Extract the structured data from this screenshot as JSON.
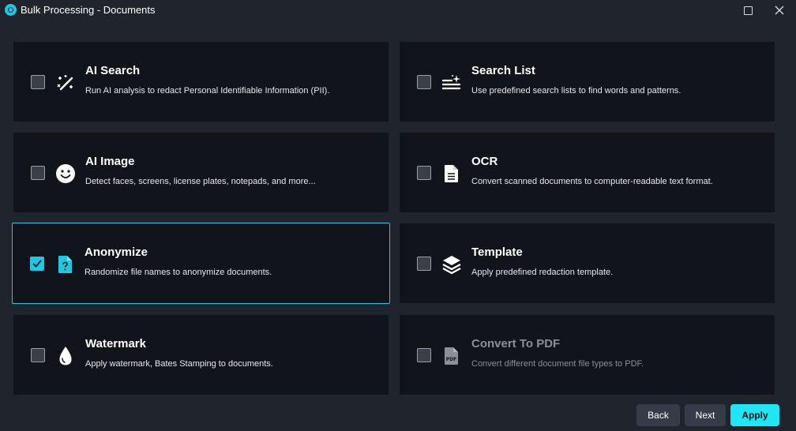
{
  "window": {
    "title": "Bulk Processing - Documents"
  },
  "colors": {
    "accent": "#1ec8e0",
    "card_bg": "#11141b",
    "window_bg": "#1f242d"
  },
  "options": [
    {
      "title": "AI Search",
      "description": "Run AI analysis to redact Personal Identifiable Information (PII).",
      "icon": "magic-wand-icon",
      "checked": false,
      "disabled": false
    },
    {
      "title": "Search List",
      "description": "Use predefined search lists to find words and patterns.",
      "icon": "sparkle-list-icon",
      "checked": false,
      "disabled": false
    },
    {
      "title": "AI Image",
      "description": "Detect faces, screens, license plates, notepads, and more...",
      "icon": "smiley-face-icon",
      "checked": false,
      "disabled": false
    },
    {
      "title": "OCR",
      "description": "Convert scanned documents to computer-readable text format.",
      "icon": "document-text-icon",
      "checked": false,
      "disabled": false
    },
    {
      "title": "Anonymize",
      "description": "Randomize file names to anonymize documents.",
      "icon": "unknown-file-icon",
      "checked": true,
      "disabled": false
    },
    {
      "title": "Template",
      "description": "Apply predefined redaction template.",
      "icon": "layers-icon",
      "checked": false,
      "disabled": false
    },
    {
      "title": "Watermark",
      "description": "Apply watermark, Bates Stamping to documents.",
      "icon": "droplet-icon",
      "checked": false,
      "disabled": false
    },
    {
      "title": "Convert To PDF",
      "description": "Convert different document file types to PDF.",
      "icon": "pdf-file-icon",
      "checked": false,
      "disabled": true
    }
  ],
  "footer": {
    "back_label": "Back",
    "next_label": "Next",
    "apply_label": "Apply"
  }
}
